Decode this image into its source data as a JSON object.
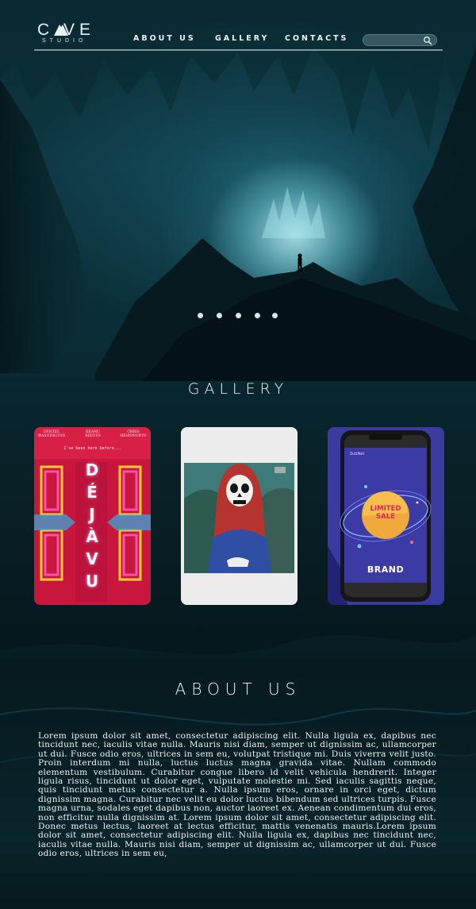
{
  "logo": {
    "main": "C  VE",
    "sub": "STUDIO"
  },
  "nav": {
    "about": "ABOUT US",
    "gallery": "GALLERY",
    "contacts": "CONTACTS"
  },
  "search": {
    "value": "",
    "placeholder": ""
  },
  "carousel": {
    "slide_count": 5,
    "active_index": 0
  },
  "gallery": {
    "title": "GALLERY",
    "items": [
      {
        "name": "deja-vu-poster",
        "credits": [
          "DENZEL\nWASHINGTON",
          "KEANU\nREEVES",
          "CHRIS\nHEMSWORTH"
        ],
        "tagline": "I've been here before...",
        "title_letters": [
          "D",
          "É",
          "J",
          "À",
          "V",
          "U"
        ]
      },
      {
        "name": "skull-painting"
      },
      {
        "name": "limited-sale-phone",
        "status_text": "SubNet",
        "badge_line1": "LIMITED",
        "badge_line2": "SALE",
        "brand": "BRAND"
      }
    ]
  },
  "about": {
    "title": "ABOUT US",
    "text": "Lorem ipsum dolor sit amet, consectetur adipiscing elit. Nulla ligula ex, dapibus nec tincidunt nec, iaculis vitae nulla. Mauris nisi diam, semper ut dignissim ac, ullamcorper ut dui. Fusce odio eros, ultrices in sem eu, volutpat tristique mi. Duis viverra velit justo. Proin interdum mi nulla, luctus luctus magna gravida vitae. Nullam commodo elementum vestibulum. Curabitur congue libero id velit vehicula hendrerit. Integer ligula risus, tincidunt ut dolor eget, vulputate molestie mi. Sed iaculis sagittis neque, quis tincidunt metus consectetur a. Nulla ipsum eros, ornare in orci eget, dictum dignissim magna. Curabitur nec velit eu dolor luctus bibendum sed ultrices turpis. Fusce magna urna, sodales eget dapibus non, auctor laoreet ex. Aenean condimentum dui eros, non efficitur nulla dignissim at. Lorem ipsum dolor sit amet, consectetur adipiscing elit. Donec metus lectus, laoreet at lectus efficitur, mattis venenatis mauris.Lorem ipsum dolor sit amet, consectetur adipiscing elit. Nulla ligula ex, dapibus nec tincidunt nec, iaculis vitae nulla. Mauris nisi diam, semper ut dignissim ac, ullamcorper ut dui. Fusce odio eros, ultrices in sem eu,"
  },
  "colors": {
    "background": "#061318",
    "accent": "#bdf2f6",
    "poster_red": "#e0224a",
    "phone_purple": "#3b3a9e",
    "sale_orange": "#f0a93c"
  }
}
